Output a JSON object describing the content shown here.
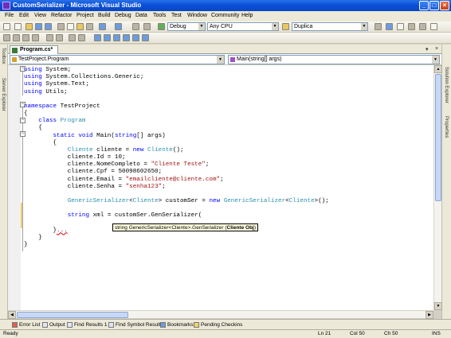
{
  "window": {
    "title": "CustomSerializer - Microsoft Visual Studio",
    "buttons": [
      "_",
      "□",
      "×"
    ]
  },
  "menu": [
    "File",
    "Edit",
    "View",
    "Refactor",
    "Project",
    "Build",
    "Debug",
    "Data",
    "Tools",
    "Test",
    "Window",
    "Community",
    "Help"
  ],
  "toolbar": {
    "config": "Debug",
    "platform": "Any CPU",
    "find": "Duplica"
  },
  "side_tabs": {
    "left": [
      "Toolbox",
      "Server Explorer"
    ],
    "right": [
      "Solution Explorer",
      "Properties"
    ]
  },
  "document": {
    "tab": "Program.cs*",
    "close": "×",
    "pin": "▾",
    "nav_left": "TestProject.Program",
    "nav_right": "Main(string[] args)"
  },
  "code_lines": [
    [
      {
        "t": "using ",
        "c": "kw"
      },
      {
        "t": "System;",
        "c": "tx"
      }
    ],
    [
      {
        "t": "using ",
        "c": "kw"
      },
      {
        "t": "System.Collections.Generic;",
        "c": "tx"
      }
    ],
    [
      {
        "t": "using ",
        "c": "kw"
      },
      {
        "t": "System.Text;",
        "c": "tx"
      }
    ],
    [
      {
        "t": "using ",
        "c": "kw"
      },
      {
        "t": "Utils;",
        "c": "tx"
      }
    ],
    [],
    [
      {
        "t": "namespace ",
        "c": "kw"
      },
      {
        "t": "TestProject",
        "c": "tx"
      }
    ],
    [
      {
        "t": "{",
        "c": "tx"
      }
    ],
    [
      {
        "t": "    class ",
        "c": "kw"
      },
      {
        "t": "Program",
        "c": "ty"
      }
    ],
    [
      {
        "t": "    {",
        "c": "tx"
      }
    ],
    [
      {
        "t": "        static void ",
        "c": "kw"
      },
      {
        "t": "Main(",
        "c": "tx"
      },
      {
        "t": "string",
        "c": "kw"
      },
      {
        "t": "[] args)",
        "c": "tx"
      }
    ],
    [
      {
        "t": "        {",
        "c": "tx"
      }
    ],
    [
      {
        "t": "            ",
        "c": "tx"
      },
      {
        "t": "Cliente",
        "c": "ty"
      },
      {
        "t": " cliente = ",
        "c": "tx"
      },
      {
        "t": "new ",
        "c": "kw"
      },
      {
        "t": "Cliente",
        "c": "ty"
      },
      {
        "t": "();",
        "c": "tx"
      }
    ],
    [
      {
        "t": "            cliente.Id = 10;",
        "c": "tx"
      }
    ],
    [
      {
        "t": "            cliente.NomeCompleto = ",
        "c": "tx"
      },
      {
        "t": "\"Cliente Teste\"",
        "c": "st"
      },
      {
        "t": ";",
        "c": "tx"
      }
    ],
    [
      {
        "t": "            cliente.Cpf = 50098602650;",
        "c": "tx"
      }
    ],
    [
      {
        "t": "            cliente.Email = ",
        "c": "tx"
      },
      {
        "t": "\"emailcliente@cliente.com\"",
        "c": "st"
      },
      {
        "t": ";",
        "c": "tx"
      }
    ],
    [
      {
        "t": "            cliente.Senha = ",
        "c": "tx"
      },
      {
        "t": "\"senha123\"",
        "c": "st"
      },
      {
        "t": ";",
        "c": "tx"
      }
    ],
    [],
    [
      {
        "t": "            ",
        "c": "tx"
      },
      {
        "t": "GenericSerializer",
        "c": "ty"
      },
      {
        "t": "<",
        "c": "tx"
      },
      {
        "t": "Cliente",
        "c": "ty"
      },
      {
        "t": "> customSer = ",
        "c": "tx"
      },
      {
        "t": "new ",
        "c": "kw"
      },
      {
        "t": "GenericSerializer",
        "c": "ty"
      },
      {
        "t": "<",
        "c": "tx"
      },
      {
        "t": "Cliente",
        "c": "ty"
      },
      {
        "t": ">();",
        "c": "tx"
      }
    ],
    [],
    [
      {
        "t": "            ",
        "c": "tx"
      },
      {
        "t": "string ",
        "c": "kw"
      },
      {
        "t": "xml = customSer.GenSerializer(",
        "c": "tx"
      }
    ],
    [],
    [
      {
        "t": "        }",
        "c": "tx"
      },
      {
        "t": "...",
        "c": "st"
      }
    ],
    [
      {
        "t": "    }",
        "c": "tx"
      }
    ],
    [
      {
        "t": "}",
        "c": "tx"
      }
    ]
  ],
  "tooltip": {
    "prefix": "string GenericSerializer<Cliente>.GenSerializer (",
    "bold": "Cliente Obj",
    "suffix": ")"
  },
  "bottom_tabs": [
    "Error List",
    "Output",
    "Find Results 1",
    "Find Symbol Results",
    "Bookmarks",
    "Pending Checkins"
  ],
  "status": {
    "message": "Ready",
    "ln": "Ln 21",
    "col": "Col 50",
    "ch": "Ch 50",
    "mode": "INS"
  }
}
